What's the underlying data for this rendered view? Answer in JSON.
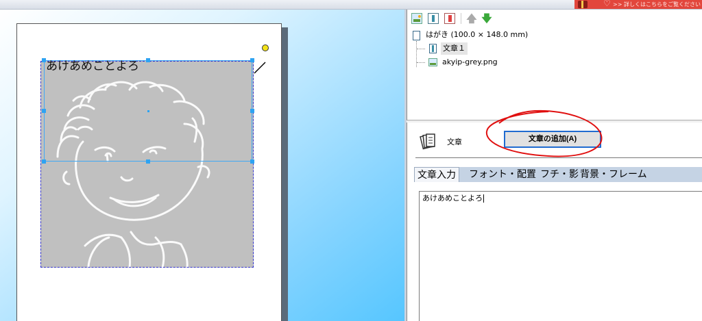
{
  "ad": {
    "text": ">> 詳しくはこちらをご覧ください"
  },
  "document": {
    "text": "あけあめことよろ"
  },
  "tree": {
    "root_label": "はがき (100.0 × 148.0 mm)",
    "items": [
      {
        "label": "文章１",
        "type": "text",
        "selected": true
      },
      {
        "label": "akyip-grey.png",
        "type": "image"
      }
    ]
  },
  "props": {
    "section_label": "文章",
    "add_button": "文章の追加(A)"
  },
  "tabs": [
    {
      "label": "文章入力",
      "active": true
    },
    {
      "label": "フォント・配置"
    },
    {
      "label": "フチ・影"
    },
    {
      "label": "背景・フレーム"
    }
  ],
  "editor": {
    "value": "あけあめことよろ"
  },
  "colors": {
    "selection": "#3fa9f5",
    "annotation": "#e01010",
    "photo_bg": "#c0c0c0"
  }
}
